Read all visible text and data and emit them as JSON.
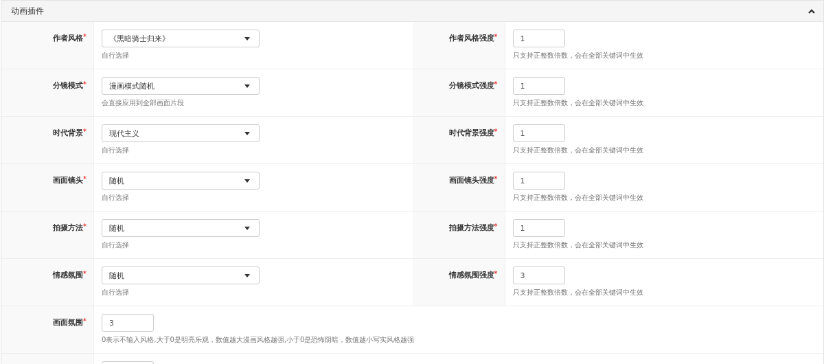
{
  "panel": {
    "title": "动画插件",
    "expanded": true
  },
  "rows": [
    {
      "cells": [
        {
          "label": "作者风格",
          "required_mark": "*",
          "kind": "select",
          "value": "《黑暗骑士归来》",
          "hint": "自行选择"
        },
        {
          "label": "作者风格强度",
          "required_mark": "*",
          "kind": "number",
          "value": "1",
          "hint": "只支持正整数倍数，会在全部关键词中生效"
        }
      ]
    },
    {
      "cells": [
        {
          "label": "分镜模式",
          "required_mark": "*",
          "kind": "select",
          "value": "漫画模式随机",
          "hint": "会直接应用到全部画面片段"
        },
        {
          "label": "分镜模式强度",
          "required_mark": "*",
          "kind": "number",
          "value": "1",
          "hint": "只支持正整数倍数，会在全部关键词中生效"
        }
      ]
    },
    {
      "cells": [
        {
          "label": "时代背景",
          "required_mark": "*",
          "kind": "select",
          "value": "现代主义",
          "hint": "自行选择"
        },
        {
          "label": "时代背景强度",
          "required_mark": "*",
          "kind": "number",
          "value": "1",
          "hint": "只支持正整数倍数，会在全部关键词中生效"
        }
      ]
    },
    {
      "cells": [
        {
          "label": "画面镜头",
          "required_mark": "*",
          "kind": "select",
          "value": "随机",
          "hint": "自行选择"
        },
        {
          "label": "画面镜头强度",
          "required_mark": "*",
          "kind": "number",
          "value": "1",
          "hint": "只支持正整数倍数，会在全部关键词中生效"
        }
      ]
    },
    {
      "cells": [
        {
          "label": "拍摄方法",
          "required_mark": "*",
          "kind": "select",
          "value": "随机",
          "hint": "自行选择"
        },
        {
          "label": "拍摄方法强度",
          "required_mark": "*",
          "kind": "number",
          "value": "1",
          "hint": "只支持正整数倍数，会在全部关键词中生效"
        }
      ]
    },
    {
      "cells": [
        {
          "label": "情感氛围",
          "required_mark": "*",
          "kind": "select",
          "value": "随机",
          "hint": "自行选择"
        },
        {
          "label": "情感氛围强度",
          "required_mark": "*",
          "kind": "number",
          "value": "3",
          "hint": "只支持正整数倍数，会在全部关键词中生效"
        }
      ]
    },
    {
      "cells": [
        {
          "label": "画面氛围",
          "required_mark": "*",
          "kind": "number",
          "value": "3",
          "hint": "0表示不输入风格,大于0是明亮乐观，数值越大漫画风格越强,小于0是恐怖阴暗，数值越小写实风格越强"
        }
      ]
    },
    {
      "cells": [
        {
          "kind": "number"
        }
      ]
    }
  ]
}
